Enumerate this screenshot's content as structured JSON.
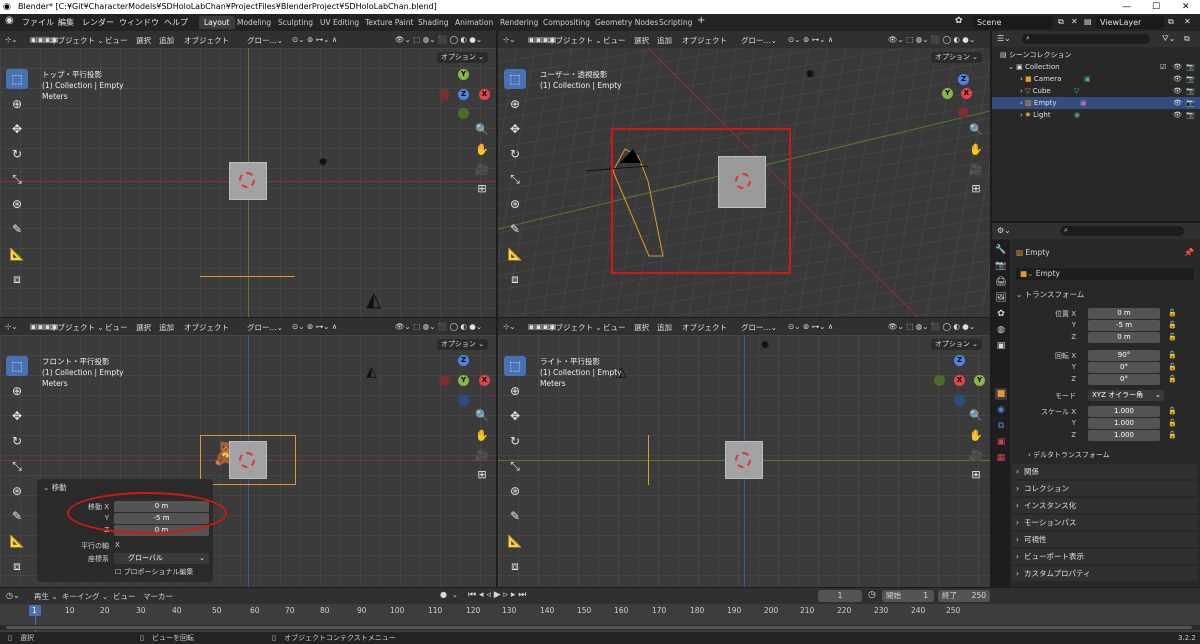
{
  "window": {
    "title": "Blender* [C:¥Git¥CharacterModels¥SDHoloLabChan¥ProjectFiles¥BlenderProject¥SDHoloLabChan.blend]"
  },
  "topbar": {
    "menus": [
      "ファイル",
      "編集",
      "レンダー",
      "ウィンドウ",
      "ヘルプ"
    ],
    "workspaces": [
      "Layout",
      "Modeling",
      "Sculpting",
      "UV Editing",
      "Texture Paint",
      "Shading",
      "Animation",
      "Rendering",
      "Compositing",
      "Geometry Nodes",
      "Scripting"
    ],
    "active_workspace": "Layout",
    "scene": "Scene",
    "view_layer": "ViewLayer"
  },
  "viewport_header": {
    "mode": "オブジェクト",
    "menus": [
      "ビュー",
      "選択",
      "追加",
      "オブジェクト"
    ],
    "transform_orientation": "グロー...",
    "options": "オプション"
  },
  "viewports": {
    "top_left": {
      "view": "トップ・平行投影",
      "collection": "(1) Collection | Empty",
      "units": "Meters"
    },
    "top_right": {
      "view": "ユーザー・透視投影",
      "collection": "(1) Collection | Empty"
    },
    "bottom_left": {
      "view": "フロント・平行投影",
      "collection": "(1) Collection | Empty",
      "units": "Meters"
    },
    "bottom_right": {
      "view": "ライト・平行投影",
      "collection": "(1) Collection | Empty",
      "units": "Meters"
    }
  },
  "gizmo_labels": {
    "x": "X",
    "y": "Y",
    "z": "Z"
  },
  "outliner": {
    "root": "シーンコレクション",
    "collection": "Collection",
    "items": [
      {
        "name": "Camera",
        "selected": false
      },
      {
        "name": "Cube",
        "selected": false
      },
      {
        "name": "Empty",
        "selected": true
      },
      {
        "name": "Light",
        "selected": false
      }
    ]
  },
  "properties": {
    "object_name": "Empty",
    "data_name": "Empty",
    "transform_title": "トランスフォーム",
    "location_label": "位置 X",
    "location": [
      "0 m",
      "-5 m",
      "0 m"
    ],
    "rotation_label": "回転 X",
    "rotation": [
      "90°",
      "0°",
      "0°"
    ],
    "mode_label": "モード",
    "mode_value": "XYZ オイラー角",
    "scale_label": "スケール X",
    "scale": [
      "1.000",
      "1.000",
      "1.000"
    ],
    "axis_y": "Y",
    "axis_z": "Z",
    "delta_transform": "デルタトランスフォーム",
    "panels": [
      "関係",
      "コレクション",
      "インスタンス化",
      "モーションパス",
      "可視性",
      "ビューポート表示",
      "カスタムプロパティ"
    ]
  },
  "operator_panel": {
    "title": "移動",
    "move_x_label": "移動 X",
    "y_label": "Y",
    "z_label": "Z",
    "values": [
      "0 m",
      "-5 m",
      "0 m"
    ],
    "constraint_label": "平行の軸",
    "constraint_value": "X",
    "orientation_label": "座標系",
    "orientation_value": "グローバル",
    "proportional": "プロポーショナル編集"
  },
  "timeline": {
    "menus": [
      "再生",
      "キーイング",
      "ビュー",
      "マーカー"
    ],
    "current_frame": "1",
    "start_label": "開始",
    "start": "1",
    "end_label": "終了",
    "end": "250",
    "ticks": [
      "1",
      "10",
      "20",
      "30",
      "40",
      "50",
      "60",
      "70",
      "80",
      "90",
      "100",
      "110",
      "120",
      "130",
      "140",
      "150",
      "160",
      "170",
      "180",
      "190",
      "200",
      "210",
      "220",
      "230",
      "240",
      "250"
    ]
  },
  "statusbar": {
    "select": "選択",
    "rotate": "ビューを回転",
    "context": "オブジェクトコンテクストメニュー",
    "version": "3.2.2"
  }
}
